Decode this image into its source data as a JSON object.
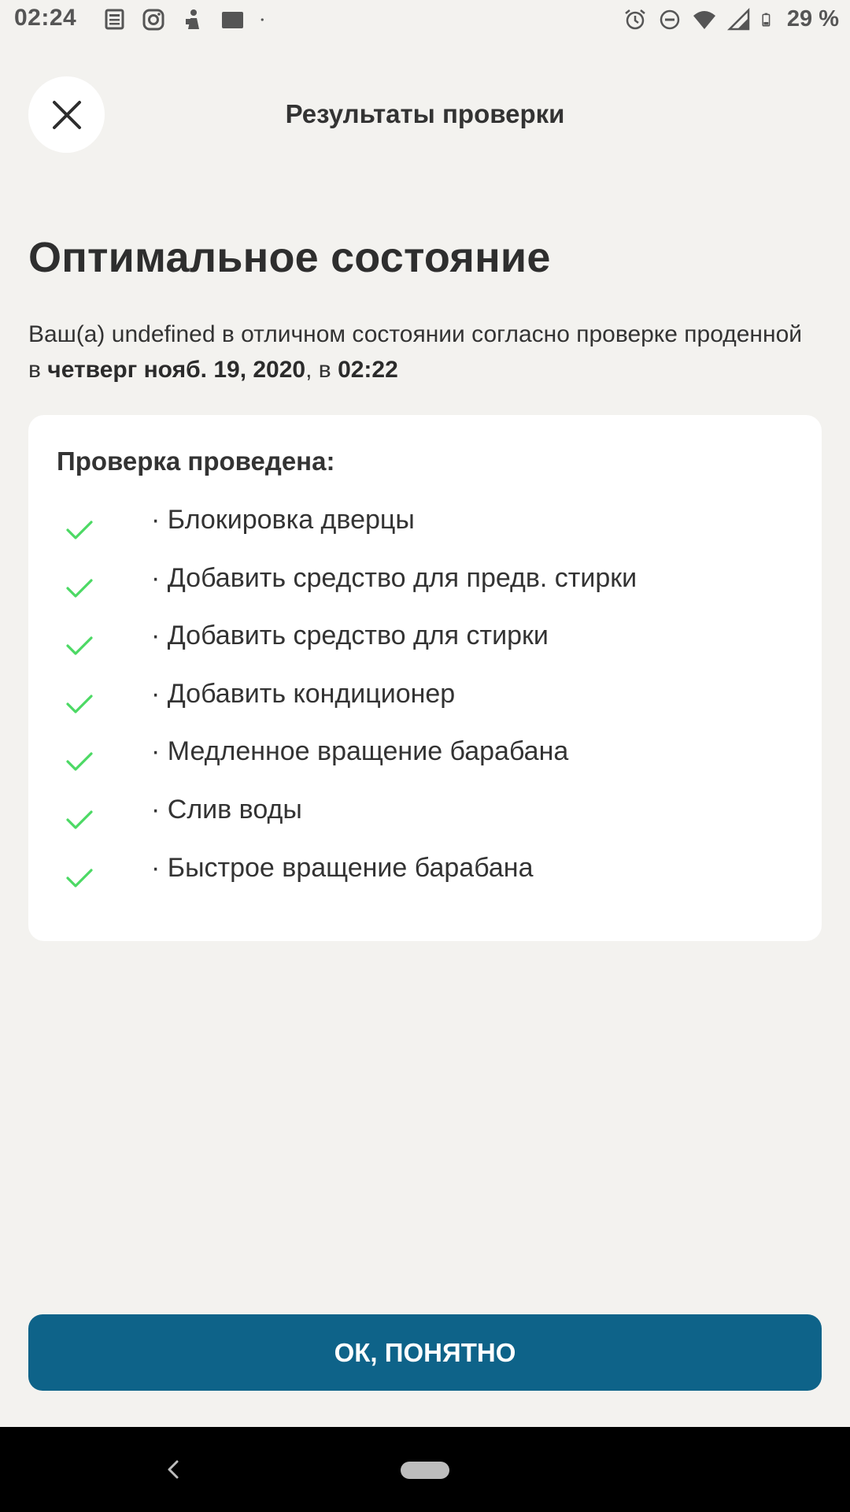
{
  "status_bar": {
    "time": "02:24",
    "left_icons": [
      "news-icon",
      "instagram-icon",
      "delivery-icon",
      "app-icon",
      "dot-icon"
    ],
    "right_icons": [
      "alarm-icon",
      "do-not-disturb-icon",
      "wifi-icon",
      "signal-icon",
      "battery-icon"
    ],
    "battery_level": "29 %"
  },
  "header": {
    "title": "Результаты проверки",
    "close_icon": "close-icon"
  },
  "main": {
    "heading": "Оптимальное состояние",
    "description": {
      "part1": "Ваш(а) undefined в отличном состоянии согласно проверке проденной в ",
      "date": "четверг нояб. 19, 2020",
      "part2": ", в ",
      "time": "02:22"
    }
  },
  "check_card": {
    "title": "Проверка проведена:",
    "items": [
      "· Блокировка дверцы",
      "· Добавить средство для предв. стирки",
      "· Добавить средство для стирки",
      "· Добавить кондиционер",
      "· Медленное вращение барабана",
      "· Слив воды",
      "· Быстрое вращение барабана"
    ],
    "item_icon": "check-icon",
    "check_color": "#4cd964"
  },
  "ok_button": {
    "label": "ОК, ПОНЯТНО",
    "color": "#0e6389"
  },
  "nav_bar": {
    "back_icon": "back-icon",
    "home_icon": "home-pill-icon"
  }
}
